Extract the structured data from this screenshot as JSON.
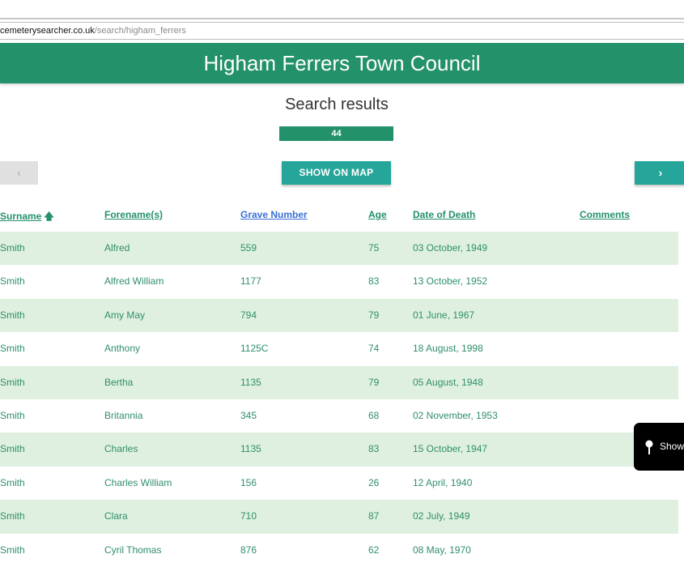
{
  "browser": {
    "url_domain": "cemeterysearcher.co.uk",
    "url_path": "/search/higham_ferrers"
  },
  "header": {
    "title": "Higham Ferrers Town Council"
  },
  "results": {
    "title": "Search results",
    "count": "44"
  },
  "pagination": {
    "prev_icon": "chevron-left-icon",
    "prev_glyph": "‹",
    "next_icon": "chevron-right-icon",
    "next_glyph": "›"
  },
  "map_button": {
    "label": "SHOW ON MAP"
  },
  "table": {
    "columns": [
      "Surname",
      "Forename(s)",
      "Grave Number",
      "Age",
      "Date of Death",
      "Comments"
    ],
    "sorted_column": "Surname",
    "sort_icon": "arrow-up-icon",
    "sort_glyph": "🡅",
    "rows": [
      [
        "Smith",
        "Alfred",
        "559",
        "75",
        "03 October, 1949",
        ""
      ],
      [
        "Smith",
        "Alfred William",
        "1177",
        "83",
        "13 October, 1952",
        ""
      ],
      [
        "Smith",
        "Amy May",
        "794",
        "79",
        "01 June, 1967",
        ""
      ],
      [
        "Smith",
        "Anthony",
        "1125C",
        "74",
        "18 August, 1998",
        ""
      ],
      [
        "Smith",
        "Bertha",
        "1135",
        "79",
        "05 August, 1948",
        ""
      ],
      [
        "Smith",
        "Britannia",
        "345",
        "68",
        "02 November, 1953",
        ""
      ],
      [
        "Smith",
        "Charles",
        "1135",
        "83",
        "15 October, 1947",
        ""
      ],
      [
        "Smith",
        "Charles William",
        "156",
        "26",
        "12 April, 1940",
        ""
      ],
      [
        "Smith",
        "Clara",
        "710",
        "87",
        "02 July, 1949",
        ""
      ],
      [
        "Smith",
        "Cyril Thomas",
        "876",
        "62",
        "08 May, 1970",
        ""
      ]
    ]
  },
  "floating_popup": {
    "label": "Show",
    "icon": "map-pin-icon"
  },
  "colors": {
    "brand_green": "#239169",
    "teal_button": "#26a69a",
    "row_stripe": "#dff0e0",
    "link_blue": "#3b6fd6"
  }
}
